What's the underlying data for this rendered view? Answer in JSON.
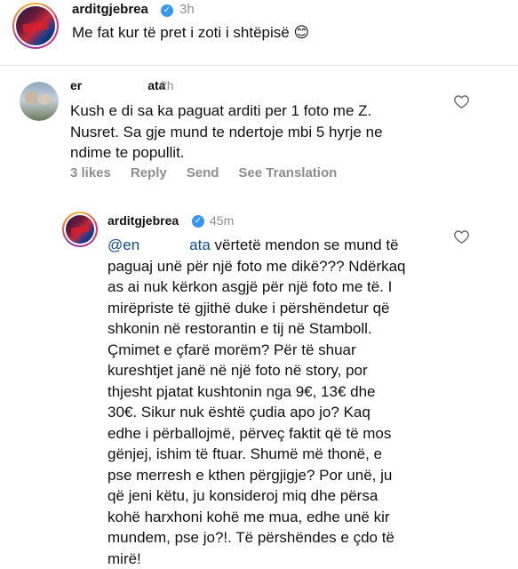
{
  "comment1": {
    "username": "arditgjebrea",
    "time": "3h",
    "text": "Me fat kur të pret i zoti i shtëpisë",
    "emoji": "😊"
  },
  "comment2": {
    "username_start": "er",
    "username_end": "ata",
    "time": "2h",
    "lines": [
      "Kush e di sa ka paguat arditi per 1 foto me Z.",
      "Nusret. Sa gje mund te ndertoje mbi 5 hyrje ne",
      "ndime te popullit."
    ],
    "actions": {
      "likes": "3 likes",
      "reply": "Reply",
      "send": "Send",
      "translate": "See Translation"
    }
  },
  "reply": {
    "username": "arditgjebrea",
    "time": "45m",
    "mention_start": "@en",
    "mention_end": "ata",
    "line1_rest": "vërtetë mendon se mund të",
    "lines": [
      "paguaj unë për një foto me dikë??? Ndërkaq",
      "as ai nuk kërkon asgjë për një foto me të. I",
      "mirëpriste të gjithë duke i përshëndetur që",
      "shkonin në restorantin e tij në Stamboll.",
      "Çmimet e çfarë morëm? Për të shuar",
      "kureshtjet janë në një foto në story, por",
      "thjesht pjatat kushtonin nga 9€, 13€ dhe",
      "30€. Sikur nuk është çudia apo jo? Kaq",
      "edhe i përballojmë, përveç faktit që të mos",
      "gënjej, ishim të ftuar. Shumë më thonë, e",
      "pse merresh e kthen përgjigje? Por unë, ju",
      "që jeni këtu, ju konsideroj miq dhe përsa",
      "kohë harxhoni kohë me mua, edhe unë kir",
      "mundem, pse jo?!. Të përshëndes e çdo të",
      "mirë!"
    ]
  }
}
